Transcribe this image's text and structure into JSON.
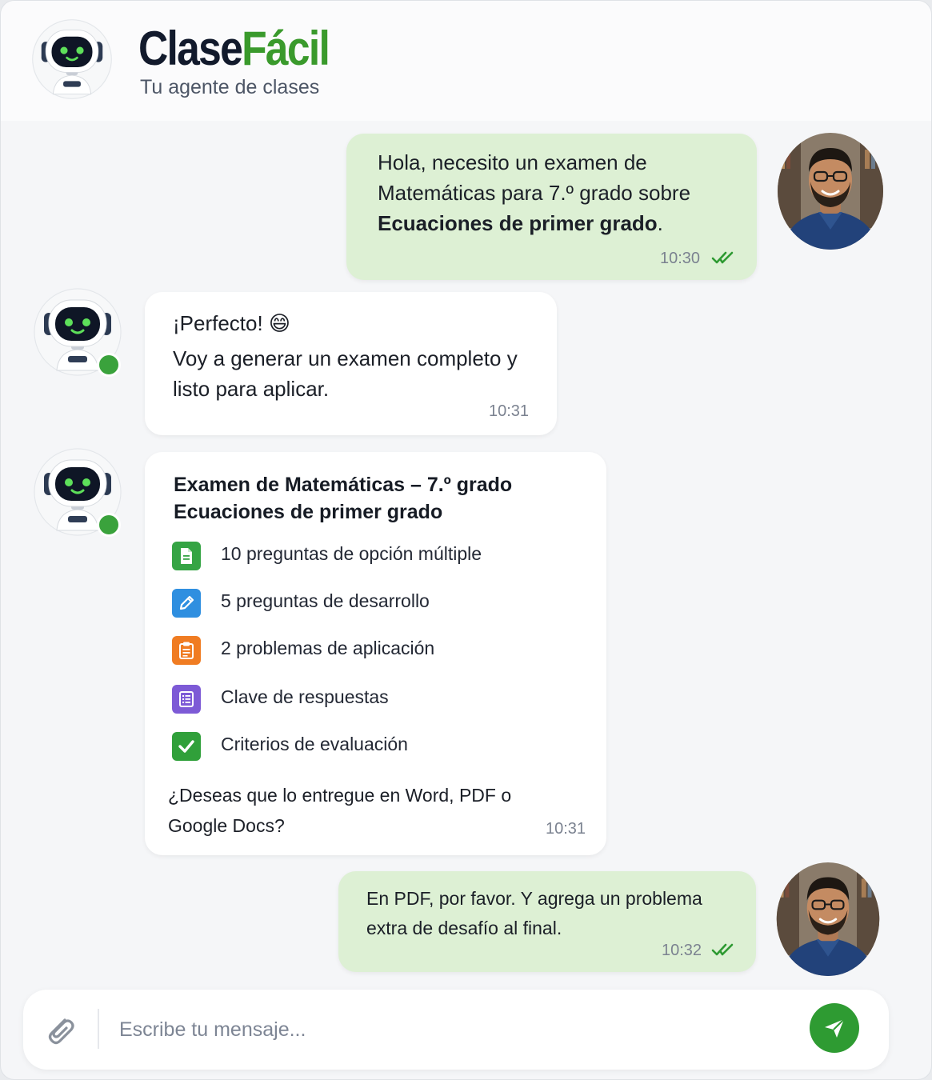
{
  "header": {
    "brand_part1": "Clase",
    "brand_part2": "Fácil",
    "subtitle": "Tu agente de clases"
  },
  "messages": {
    "m1": {
      "line1": "Hola, necesito un examen de",
      "line2": "Matemáticas para 7.º grado sobre",
      "line3": "Ecuaciones de primer grado",
      "line3_end": ".",
      "time": "10:30"
    },
    "m2": {
      "line1": "¡Perfecto! 😄",
      "line2": "Voy a generar un examen completo y",
      "line3": "listo para aplicar.",
      "time": "10:31"
    },
    "m3": {
      "title1": "Examen de Matemáticas – 7.º grado",
      "title2": "Ecuaciones de primer grado",
      "items": [
        {
          "label": "10 preguntas de opción múltiple",
          "icon": "document-icon",
          "color": "#35a444"
        },
        {
          "label": "5 preguntas de desarrollo",
          "icon": "pencil-icon",
          "color": "#2f8fe0"
        },
        {
          "label": "2 problemas de aplicación",
          "icon": "clipboard-icon",
          "color": "#f07c22"
        },
        {
          "label": "Clave de respuestas",
          "icon": "list-icon",
          "color": "#7d5ad6"
        },
        {
          "label": "Criterios de evaluación",
          "icon": "checkmark-icon",
          "color": "#30a03a"
        }
      ],
      "question1": "¿Deseas que lo entregue en Word, PDF o",
      "question2": "Google Docs?",
      "time": "10:31"
    },
    "m4": {
      "line1": "En PDF, por favor. Y agrega un problema",
      "line2": "extra de desafío al final.",
      "time": "10:32"
    }
  },
  "input": {
    "placeholder": "Escribe tu mensaje..."
  },
  "colors": {
    "brand_dark": "#121a2c",
    "brand_green": "#3a9a2c",
    "user_bubble": "#ddf0d4",
    "bot_bubble": "#ffffff",
    "send_button": "#2e9b32"
  }
}
